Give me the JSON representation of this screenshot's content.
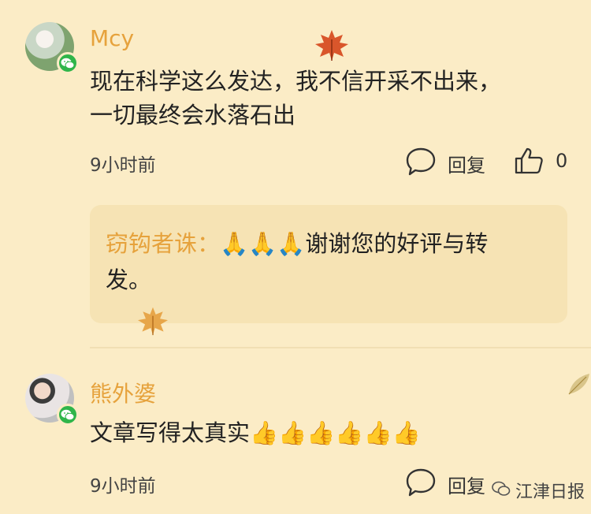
{
  "comments": [
    {
      "author": "Mcy",
      "text_line1": "现在科学这么发达，我不信开采不出来，",
      "text_line2": "一切最终会水落石出",
      "time": "9小时前",
      "reply_label": "回复",
      "likes": "0",
      "reply": {
        "author": "窃钩者诛：",
        "emojis": "🙏🙏🙏",
        "text_line1": "谢谢您的好评与转",
        "text_line2": "发。"
      }
    },
    {
      "author": "熊外婆",
      "text": "文章写得太真实",
      "emojis": "👍👍👍👍👍👍",
      "time": "9小时前",
      "reply_label": "回复"
    }
  ],
  "watermark": "江津日报",
  "icons": {
    "comment": "speech-bubble-icon",
    "like": "thumbs-up-icon",
    "wechat": "wechat-icon",
    "leaf": "maple-leaf-icon"
  },
  "colors": {
    "background": "#fbecc6",
    "name": "#e6a23c",
    "reply_box": "#f6e3b4",
    "wechat_green": "#2fb54a"
  }
}
